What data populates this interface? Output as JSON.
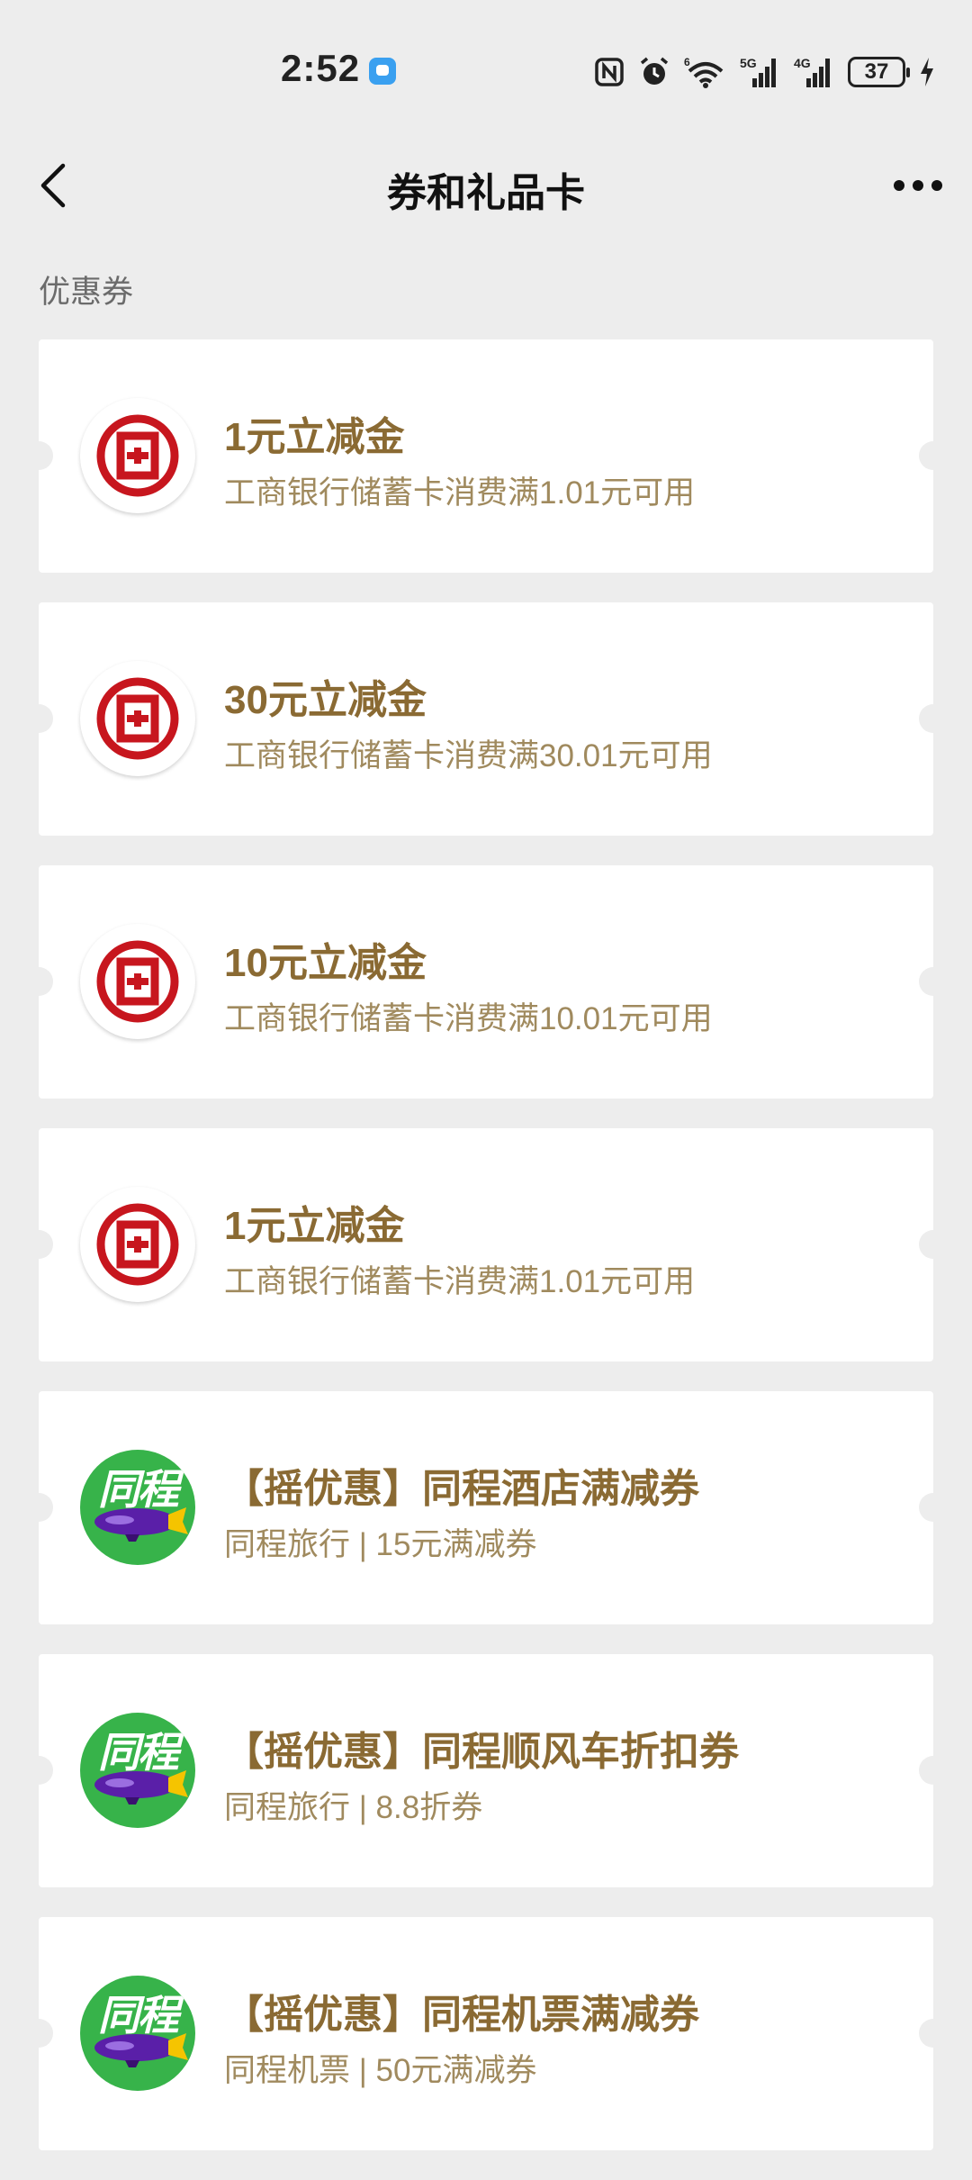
{
  "status_bar": {
    "time": "2:52",
    "battery_level": "37",
    "network_labels": [
      "5G",
      "4G"
    ]
  },
  "nav": {
    "title": "券和礼品卡"
  },
  "section": {
    "label": "优惠券"
  },
  "coupons": [
    {
      "title": "1元立减金",
      "subtitle": "工商银行储蓄卡消费满1.01元可用",
      "logo": "icbc-logo"
    },
    {
      "title": "30元立减金",
      "subtitle": "工商银行储蓄卡消费满30.01元可用",
      "logo": "icbc-logo"
    },
    {
      "title": "10元立减金",
      "subtitle": "工商银行储蓄卡消费满10.01元可用",
      "logo": "icbc-logo"
    },
    {
      "title": "1元立减金",
      "subtitle": "工商银行储蓄卡消费满1.01元可用",
      "logo": "icbc-logo"
    },
    {
      "title": "【摇优惠】同程酒店满减券",
      "subtitle": "同程旅行 | 15元满减券",
      "logo": "tongcheng-logo",
      "logo_text": "同程"
    },
    {
      "title": "【摇优惠】同程顺风车折扣券",
      "subtitle": "同程旅行 | 8.8折券",
      "logo": "tongcheng-logo",
      "logo_text": "同程"
    },
    {
      "title": "【摇优惠】同程机票满减券",
      "subtitle": "同程机票 | 50元满减券",
      "logo": "tongcheng-logo",
      "logo_text": "同程"
    }
  ],
  "colors": {
    "background": "#ededed",
    "card": "#ffffff",
    "coupon_title": "#8a6a33",
    "coupon_subtitle": "#a08a5e",
    "icbc_red": "#c7161e",
    "tongcheng_green": "#37b34a",
    "tongcheng_purple": "#5a1fa8"
  }
}
